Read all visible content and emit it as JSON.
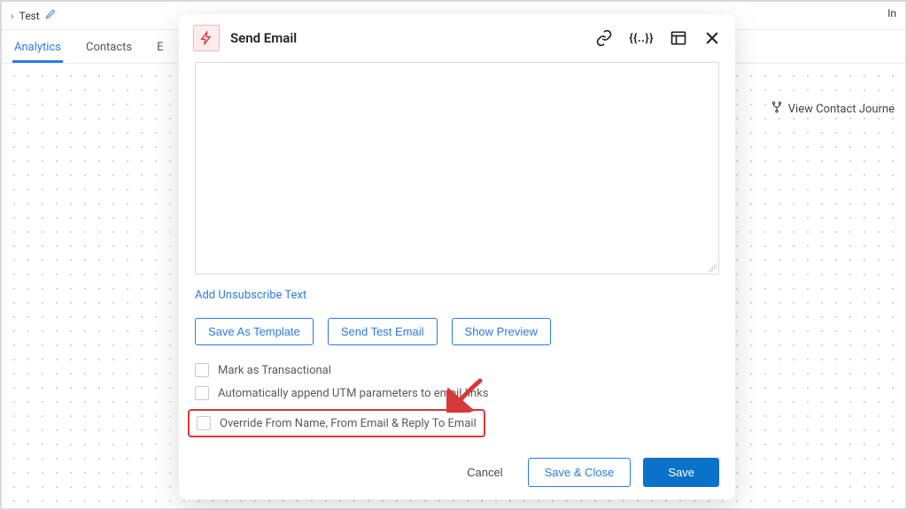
{
  "breadcrumb": {
    "title": "Test"
  },
  "topright_label": "In",
  "tabs": {
    "analytics": "Analytics",
    "contacts": "Contacts",
    "elabel": "E"
  },
  "journey": {
    "label": "View Contact Journe"
  },
  "modal": {
    "title": "Send Email",
    "header_actions": {
      "tokens_label": "{{..}}"
    },
    "unsubscribe_link": "Add Unsubscribe Text",
    "buttons": {
      "save_template": "Save As Template",
      "send_test": "Send Test Email",
      "show_preview": "Show Preview"
    },
    "checks": {
      "transactional": "Mark as Transactional",
      "utm": "Automatically append UTM parameters to email links",
      "override": "Override From Name, From Email & Reply To Email"
    },
    "footer": {
      "cancel": "Cancel",
      "save_close": "Save & Close",
      "save": "Save"
    }
  }
}
